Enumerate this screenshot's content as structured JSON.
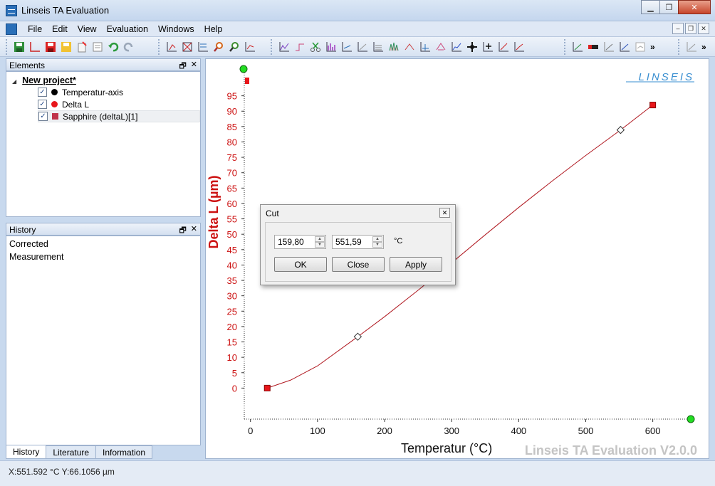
{
  "window": {
    "title": "Linseis TA Evaluation"
  },
  "menu": {
    "items": [
      "File",
      "Edit",
      "View",
      "Evaluation",
      "Windows",
      "Help"
    ]
  },
  "elements_panel": {
    "title": "Elements",
    "root": "New project*",
    "items": [
      {
        "label": "Temperatur-axis",
        "color": "#000000",
        "marker": "dot"
      },
      {
        "label": "Delta L",
        "color": "#e8161b",
        "marker": "dot"
      },
      {
        "label": "Sapphire (deltaL)[1]",
        "color": "#c0334a",
        "marker": "square"
      }
    ]
  },
  "history_panel": {
    "title": "History",
    "items": [
      "Corrected",
      "Measurement"
    ]
  },
  "bottom_tabs": [
    "History",
    "Literature",
    "Information"
  ],
  "plot": {
    "brand": "LINSEIS",
    "watermark": "Linseis TA Evaluation V2.0.0",
    "xlabel": "Temperatur (°C)",
    "ylabel": "Delta L (µm)",
    "curve_color": "#b01820",
    "axis_color": "#cc1111"
  },
  "chart_data": {
    "type": "line",
    "xlabel": "Temperatur (°C)",
    "ylabel": "Delta L (µm)",
    "xlim": [
      -5,
      645
    ],
    "ylim": [
      -5,
      100
    ],
    "xticks": [
      0,
      100,
      200,
      300,
      400,
      500,
      600
    ],
    "yticks": [
      0,
      5,
      10,
      15,
      20,
      25,
      30,
      35,
      40,
      45,
      50,
      55,
      60,
      65,
      70,
      75,
      80,
      85,
      90,
      95
    ],
    "series": [
      {
        "x": [
          25,
          60,
          100,
          160,
          200,
          250,
          300,
          350,
          400,
          450,
          500,
          552,
          600
        ],
        "y": [
          0,
          2.6,
          7.2,
          16.7,
          23.2,
          31.8,
          40.7,
          49.8,
          58.7,
          67.3,
          75.6,
          83.9,
          92.0
        ]
      }
    ],
    "endpoints": [
      {
        "x": 25,
        "y": 0
      },
      {
        "x": 600,
        "y": 92
      }
    ],
    "cut_markers": [
      {
        "x": 160,
        "y": 16.7
      },
      {
        "x": 552,
        "y": 83.9
      }
    ]
  },
  "dialog": {
    "title": "Cut",
    "from": "159,80",
    "to": "551,59",
    "unit": "°C",
    "ok": "OK",
    "close": "Close",
    "apply": "Apply"
  },
  "status": {
    "text": "X:551.592 °C Y:66.1056 µm"
  }
}
